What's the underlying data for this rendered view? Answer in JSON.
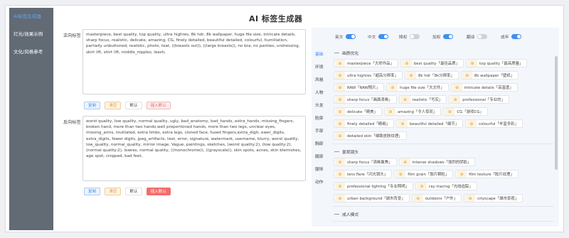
{
  "sidebar": {
    "items": [
      {
        "label": "AI标签生成器",
        "active": true
      },
      {
        "label": "灯光/效果示例",
        "active": false
      },
      {
        "label": "文化/风格参考",
        "active": false
      }
    ]
  },
  "title": "AI 标签生成器",
  "positive": {
    "label": "正向标签",
    "text": "masterpiece, best quality, top quality, ultra highres, 8k hdr, 8k wallpaper, huge file size, intricate details, sharp focus, realistic, delicate, amazing, CG, finely detailed, beautiful detailed, colourful, humiliation, partially unbuttoned, realistic, photo, teat, ((breasts out)), ((large breasts)), no bra, no panties, undressing, skirt lift, shirt lift, middle_nipples, leash,",
    "buttons": {
      "copy": "复制",
      "clear": "清空",
      "default": "默认",
      "insert_default": "插入默认"
    }
  },
  "negative": {
    "label": "反向标签",
    "text": "worst quality, low quality, normal quality, ugly, bad_anatomy, bad_hands, extra_hands, missing_fingers, broken hand, more than two hands,well proportioned hands, more than two legs, unclear eyes, missing_arms, mutilated, extra limbs, extra legs, cloned face, fused fingers,extra_digit, ewer_digits, extra_digits, fewer digits, jpeg_artifacts, text, error, signature, watermark, username, blurry, worst quality, low_quality, normal_quality, mirror image, Vague, paintings, sketches, (worst quality:2), (low quality:2), (normal quality:2), lowres, normal quality, ((monochrome)), ((grayscale)), skin spots, acnes, skin blemishes, age spot, cropped, bad feet,",
    "buttons": {
      "copy": "复制",
      "clear": "清空",
      "default": "默认",
      "insert_default": "插入默认"
    }
  },
  "toggles": [
    {
      "label": "英文",
      "on": true
    },
    {
      "label": "中文",
      "on": true
    },
    {
      "label": "降权",
      "on": false
    },
    {
      "label": "加权",
      "on": true
    },
    {
      "label": "翻译",
      "on": false
    },
    {
      "label": "成年",
      "on": true
    }
  ],
  "categories": [
    "基础",
    "环境",
    "风格",
    "人物",
    "头发",
    "脸部",
    "手部",
    "胸部",
    "腿部",
    "服饰",
    "动作"
  ],
  "sections": [
    {
      "title": "画质优化",
      "rows": [
        [
          "masterpiece「大师作品」",
          "best quality「最佳品质」",
          "top quality「最高质量」"
        ],
        [
          "ultra highres「超高分辨率」",
          "8k hdr「8k分辨率」",
          "8k wallpaper「壁纸」"
        ],
        [
          "RAW「RAW照片」",
          "huge file size「大文件」",
          "intricate details「高富度」"
        ],
        [
          "sharp focus「画面清晰」",
          "realistic「写实」",
          "professional「专业的」"
        ],
        [
          "delicate「精美」",
          "amazing「令人惊叹」",
          "CG「游戏CG」"
        ],
        [
          "finely detailed「精细」",
          "beautiful detailed「细节」",
          "colourful「丰富多彩」"
        ],
        [
          "detailed skin「细致皮肤纹理」"
        ]
      ]
    },
    {
      "title": "景观镜头",
      "rows": [
        [
          "sharp focus「清晰聚焦」",
          "intense shadows「强烈的阴影」"
        ],
        [
          "lens flare「闪光镜头」",
          "film grain「胶片颗粒」",
          "film texture「胶片纹理」"
        ],
        [
          "professional lighting「专业照明」",
          "ray tracing「光线追踪」"
        ],
        [
          "urban background「城市背景」",
          "outdoors「户外」",
          "cityscape「城市景观」"
        ]
      ]
    },
    {
      "title": "成人模式",
      "rows": []
    }
  ],
  "icons": {
    "tag_add": "plus-icon"
  },
  "colors": {
    "accent": "#3f8ff0",
    "sidebar": "#626a74",
    "danger": "#f56c6c"
  }
}
